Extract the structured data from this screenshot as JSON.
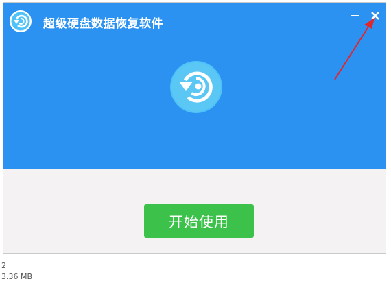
{
  "window": {
    "title": "超级硬盘数据恢复软件",
    "start_label": "开始使用"
  },
  "icons": {
    "app_logo": "restore-circle-icon",
    "minimize": "minimize-icon",
    "close": "close-icon",
    "center_logo": "restore-circle-icon"
  },
  "background": {
    "line1": "2",
    "size_text": "3.36 MB"
  },
  "colors": {
    "header_blue": "#2c92f2",
    "start_green": "#3cc24a",
    "body_bg": "#f4f2f3",
    "logo_circle": "#4fc3f7",
    "annotation_red": "#e0262b"
  }
}
